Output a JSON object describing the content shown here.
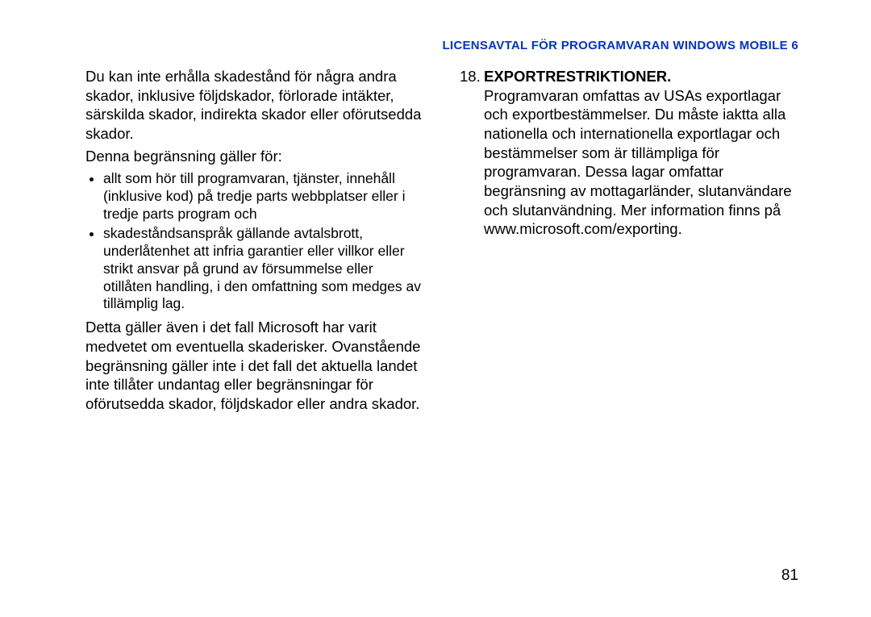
{
  "header": "LICENSAVTAL FÖR PROGRAMVARAN WINDOWS MOBILE 6",
  "left": {
    "para1": "Du kan inte erhålla skadestånd för några andra skador, inklusive följdskador, förlorade intäkter, särskilda skador, indirekta skador eller oförutsedda skador.",
    "para2": "Denna begränsning gäller för:",
    "bullet1": "allt som hör till programvaran, tjänster, innehåll (inklusive kod) på tredje parts webbplatser eller i tredje parts program och",
    "bullet2": "skadeståndsanspråk gällande avtalsbrott, underlåtenhet att infria garantier eller villkor eller strikt ansvar på grund av försummelse eller otillåten handling, i den omfattning som medges av tillämplig lag.",
    "para3": "Detta gäller även i det fall Microsoft har varit medvetet om eventuella skaderisker. Ovanstående begränsning gäller inte i det fall det aktuella landet inte tillåter undantag eller begränsningar för oförutsedda skador, följdskador eller andra skador."
  },
  "right": {
    "item18": {
      "num": "18.",
      "heading": "EXPORTRESTRIKTIONER.",
      "body": "Programvaran omfattas av USAs exportlagar och exportbestämmelser. Du måste iaktta alla nationella och internationella exportlagar och bestämmelser som är tillämpliga för programvaran. Dessa lagar omfattar begränsning av mottagarländer, slutanvändare och slutanvändning. Mer information finns på www.microsoft.com/exporting."
    }
  },
  "pagenum": "81"
}
